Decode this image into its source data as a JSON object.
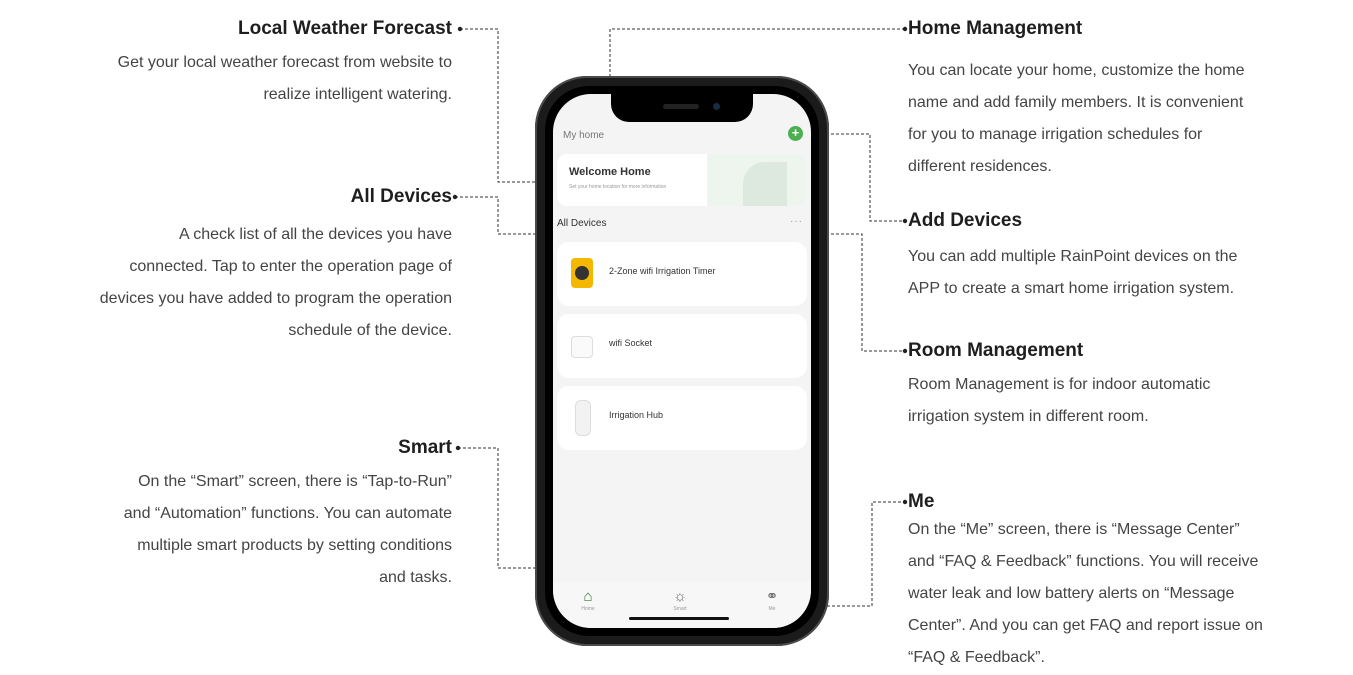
{
  "annotations": {
    "local_weather": {
      "title": "Local Weather Forecast",
      "lines": [
        "Get your local weather forecast from website to",
        "realize intelligent watering."
      ]
    },
    "all_devices": {
      "title": "All Devices",
      "lines": [
        "A check list of all the devices you have",
        "connected. Tap to enter the operation page of",
        "devices you have added to program the operation",
        "schedule of the device."
      ]
    },
    "smart": {
      "title": "Smart",
      "lines": [
        "On the “Smart” screen, there is “Tap-to-Run”",
        "and “Automation” functions. You can automate",
        "multiple smart products by setting conditions",
        "and tasks."
      ]
    },
    "home_management": {
      "title": "Home Management",
      "lines": [
        "You can locate your home, customize the home",
        "name and add family members. It is convenient",
        " for you to manage irrigation schedules for",
        "different residences."
      ]
    },
    "add_devices": {
      "title": "Add Devices",
      "lines": [
        "You can add multiple RainPoint devices on the",
        "APP to create a smart home irrigation system."
      ]
    },
    "room_management": {
      "title": "Room Management",
      "lines": [
        "Room Management is for indoor automatic",
        "irrigation system in different room."
      ]
    },
    "me": {
      "title": "Me",
      "lines": [
        "On the “Me” screen, there is “Message Center”",
        "and “FAQ & Feedback” functions. You will receive",
        "water leak and low battery alerts on “Message",
        "Center”. And you can get FAQ and report issue on",
        " “FAQ & Feedback”."
      ]
    }
  },
  "app": {
    "home_label": "My home",
    "add_button": "+",
    "welcome_title": "Welcome Home",
    "welcome_sub": "Set your home location for more information",
    "devices_header": "All Devices",
    "more": "···",
    "devices": [
      {
        "label": "2-Zone wifi Irrigation Timer",
        "icon": "irrigation-timer-icon"
      },
      {
        "label": "wifi Socket",
        "icon": "socket-icon"
      },
      {
        "label": "Irrigation Hub",
        "icon": "hub-icon"
      }
    ],
    "tabs": [
      {
        "label": "Home",
        "icon": "home-icon",
        "color": "#2e7d32"
      },
      {
        "label": "Smart",
        "icon": "sun-icon",
        "color": "#555555"
      },
      {
        "label": "Me",
        "icon": "me-icon",
        "color": "#555555"
      }
    ]
  }
}
